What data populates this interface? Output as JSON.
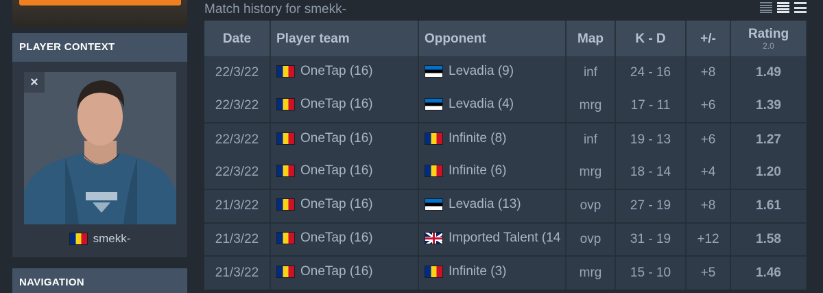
{
  "sidebar": {
    "context_header": "PLAYER CONTEXT",
    "close_label": "×",
    "player": {
      "name": "smekk-",
      "flag": "ro"
    },
    "navigation_header": "NAVIGATION"
  },
  "main": {
    "title": "Match history for smekk-",
    "columns": {
      "date": "Date",
      "player_team": "Player team",
      "opponent": "Opponent",
      "map": "Map",
      "kd": "K - D",
      "diff": "+/-",
      "rating": "Rating",
      "rating_sub": "2.0"
    },
    "rows": [
      {
        "date": "22/3/22",
        "team_flag": "ro",
        "team": "OneTap (16)",
        "opp_flag": "ee",
        "opponent": "Levadia (9)",
        "map": "inf",
        "kd": "24 - 16",
        "diff": "+8",
        "rating": "1.49"
      },
      {
        "date": "22/3/22",
        "team_flag": "ro",
        "team": "OneTap (16)",
        "opp_flag": "ee",
        "opponent": "Levadia (4)",
        "map": "mrg",
        "kd": "17 - 11",
        "diff": "+6",
        "rating": "1.39"
      },
      {
        "date": "22/3/22",
        "team_flag": "ro",
        "team": "OneTap (16)",
        "opp_flag": "ro",
        "opponent": "Infinite (8)",
        "map": "inf",
        "kd": "19 - 13",
        "diff": "+6",
        "rating": "1.27"
      },
      {
        "date": "22/3/22",
        "team_flag": "ro",
        "team": "OneTap (16)",
        "opp_flag": "ro",
        "opponent": "Infinite (6)",
        "map": "mrg",
        "kd": "18 - 14",
        "diff": "+4",
        "rating": "1.20"
      },
      {
        "date": "21/3/22",
        "team_flag": "ro",
        "team": "OneTap (16)",
        "opp_flag": "ee",
        "opponent": "Levadia (13)",
        "map": "ovp",
        "kd": "27 - 19",
        "diff": "+8",
        "rating": "1.61"
      },
      {
        "date": "21/3/22",
        "team_flag": "ro",
        "team": "OneTap (16)",
        "opp_flag": "gb",
        "opponent": "Imported Talent (14",
        "map": "ovp",
        "kd": "31 - 19",
        "diff": "+12",
        "rating": "1.58"
      },
      {
        "date": "21/3/22",
        "team_flag": "ro",
        "team": "OneTap (16)",
        "opp_flag": "ro",
        "opponent": "Infinite (3)",
        "map": "mrg",
        "kd": "15 - 10",
        "diff": "+5",
        "rating": "1.46"
      }
    ]
  },
  "colors": {
    "accent_orange": "#f0801f",
    "positive_green": "#5bbd57",
    "rating_bar": "#4cb14a",
    "header_bg": "#3c4a5a",
    "row_bg": "#2f3b48"
  }
}
